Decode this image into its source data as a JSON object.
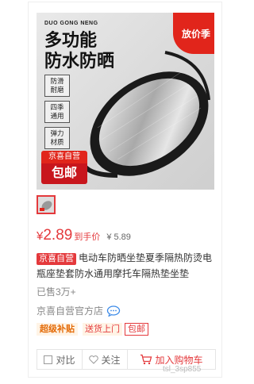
{
  "product_image": {
    "brand_small": "DUO GONG NENG",
    "headline_line1": "多功能",
    "headline_line2": "防水防晒",
    "feature_tags": [
      "防滑\n耐磨",
      "四季\n通用",
      "弹力\n材质"
    ],
    "season_badge": "放价季",
    "jd_top": "京喜自营",
    "jd_bottom": "包邮"
  },
  "price": {
    "symbol": "¥",
    "value": "2.89",
    "tag": "到手价",
    "original": "¥ 5.89"
  },
  "title": {
    "badge": "京喜自营",
    "text": "电动车防晒坐垫夏季隔热防烫电瓶座垫套防水通用摩托车隔热垫坐垫"
  },
  "sold_text": "已售3万+",
  "shop_name": "京喜自营官方店",
  "promo_tags": [
    "超级补贴",
    "送货上门",
    "包邮"
  ],
  "actions": {
    "compare": "对比",
    "follow": "关注",
    "add_cart": "加入购物车"
  },
  "watermark": "tsl_3sp855",
  "colors": {
    "accent": "#e4393c",
    "subsidy": "#e46c0a"
  }
}
